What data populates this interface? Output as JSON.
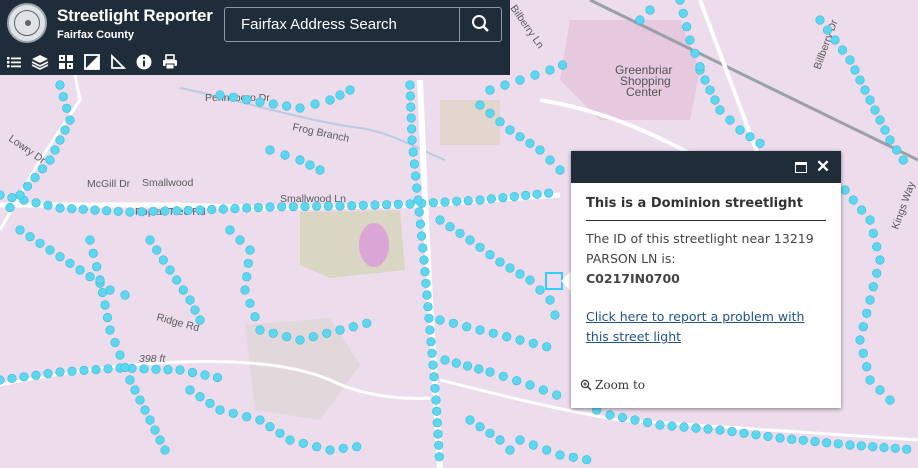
{
  "app": {
    "title": "Streetlight Reporter",
    "subtitle": "Fairfax County"
  },
  "search": {
    "placeholder": "Fairfax Address Search"
  },
  "toolbar": {
    "tools": [
      "list-icon",
      "layers-icon",
      "basemap-gallery-icon",
      "swipe-icon",
      "measure-icon",
      "info-icon",
      "print-icon"
    ]
  },
  "popup": {
    "title": "This is a Dominion streetlight",
    "body": "The ID of this streetlight near 13219 PARSON LN is:",
    "light_id": "C0217IN0700",
    "link_text": "Click here to report a problem with this street light",
    "zoom_label": "Zoom to"
  },
  "map": {
    "labels": {
      "poplar_tree_rd": "Poplar Tree Rd",
      "smallwood_ln": "Smallwood Ln",
      "smallwood": "Smallwood",
      "mcgill_dr": "McGill Dr",
      "lowry_dr": "Lowry Dr",
      "frog_branch": "Frog Branch",
      "pennsboro_dr": "Pennsboro Dr",
      "ridge_rd": "Ridge Rd",
      "elevation": "398 ft",
      "greenbriar": "Greenbriar",
      "shopping": "Shopping",
      "center": "Center",
      "billberry": "Billberry Dr",
      "kings_way": "Kings Way",
      "bilberry_ln": "Bilberry Ln"
    },
    "colors": {
      "base": "#ecdcec",
      "road": "#ffffff",
      "park": "#d6d6c2",
      "water": "#b9cde0",
      "streetlight": "#5cd7f0",
      "selection": "#33ccff"
    }
  }
}
